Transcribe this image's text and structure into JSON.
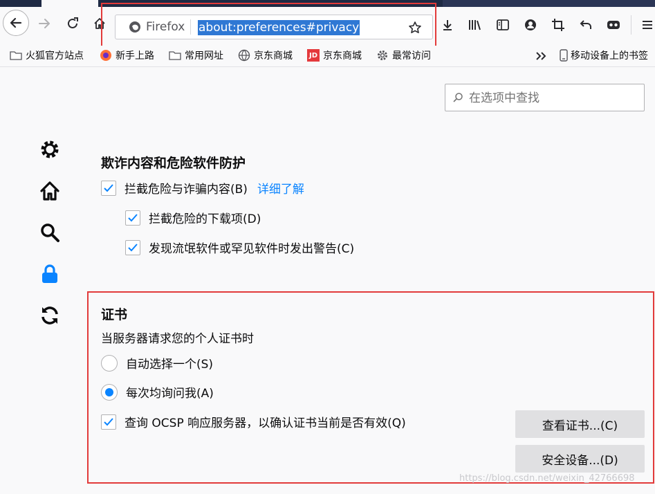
{
  "browser": {
    "urlbar": {
      "identity_label": "Firefox",
      "url": "about:preferences#privacy"
    }
  },
  "bookmarks": [
    {
      "label": "火狐官方站点",
      "icon": "folder-icon"
    },
    {
      "label": "新手上路",
      "icon": "firefox-icon"
    },
    {
      "label": "常用网址",
      "icon": "folder-icon"
    },
    {
      "label": "京东商城",
      "icon": "globe-icon"
    },
    {
      "label": "京东商城",
      "icon": "jd-icon"
    },
    {
      "label": "最常访问",
      "icon": "gear-icon"
    },
    {
      "label": "移动设备上的书签",
      "icon": "mobile-icon"
    }
  ],
  "jd_logo_text": "JD",
  "search": {
    "placeholder": "在选项中查找"
  },
  "deceptive": {
    "title": "欺诈内容和危险软件防护",
    "block_dangerous": "拦截危险与诈骗内容(B)",
    "learn_more": "详细了解",
    "block_downloads": "拦截危险的下载项(D)",
    "warn_unwanted": "发现流氓软件或罕见软件时发出警告(C)"
  },
  "certificates": {
    "title": "证书",
    "subtitle": "当服务器请求您的个人证书时",
    "auto_select": "自动选择一个(S)",
    "ask_every_time": "每次均询问我(A)",
    "ocsp": "查询 OCSP 响应服务器，以确认证书当前是否有效(Q)",
    "view_certs_button": "查看证书...(C)",
    "security_devices_button": "安全设备...(D)"
  },
  "watermark": "https://blog.csdn.net/weixin_42766698",
  "colors": {
    "accent": "#0a84ff",
    "highlight_box": "#e23a3a",
    "url_selection": "#2f78d4"
  }
}
